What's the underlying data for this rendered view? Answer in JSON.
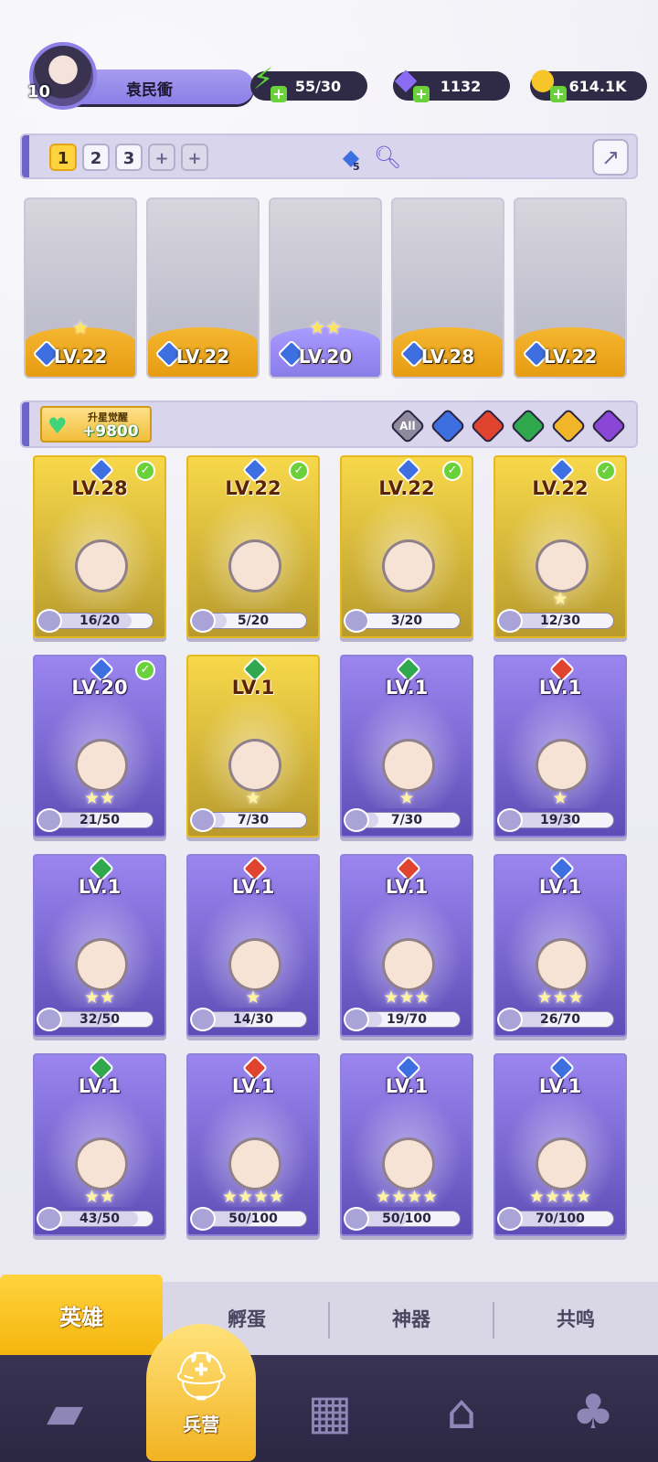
{
  "player": {
    "level": "10",
    "name": "袁民衝"
  },
  "resources": [
    {
      "icon": "energy-icon",
      "value": "55/30",
      "color": "#5fd13a"
    },
    {
      "icon": "gem-icon",
      "value": "1132",
      "color": "#8a6cf2"
    },
    {
      "icon": "coin-icon",
      "value": "614.1K",
      "color": "#f5c52a"
    }
  ],
  "team": {
    "tabs": [
      "1",
      "2",
      "3"
    ],
    "add_labels": [
      "+",
      "+"
    ],
    "active_tab": "1",
    "badge_count": "5"
  },
  "team_slots": [
    {
      "lv": "LV.22",
      "stars": "★",
      "frame": "gold"
    },
    {
      "lv": "LV.22",
      "stars": "",
      "frame": "gold"
    },
    {
      "lv": "LV.20",
      "stars": "★★",
      "frame": "purple"
    },
    {
      "lv": "LV.28",
      "stars": "",
      "frame": "gold"
    },
    {
      "lv": "LV.22",
      "stars": "",
      "frame": "gold"
    }
  ],
  "awaken": {
    "title": "升星觉醒",
    "value": "+9800"
  },
  "filters": [
    {
      "label": "All",
      "color": "#8f8a9e"
    },
    {
      "label": "",
      "color": "#3d6fe0"
    },
    {
      "label": "",
      "color": "#e0442e"
    },
    {
      "label": "",
      "color": "#2fa84e"
    },
    {
      "label": "",
      "color": "#f1b52a"
    },
    {
      "label": "",
      "color": "#8a47d6"
    }
  ],
  "heroes": [
    {
      "lv": "LV.28",
      "progress": "16/20",
      "fill": 0.8,
      "frame": "gold",
      "element": "#3d6fe0",
      "checked": true,
      "stars": ""
    },
    {
      "lv": "LV.22",
      "progress": "5/20",
      "fill": 0.25,
      "frame": "gold",
      "element": "#3d6fe0",
      "checked": true,
      "stars": ""
    },
    {
      "lv": "LV.22",
      "progress": "3/20",
      "fill": 0.15,
      "frame": "gold",
      "element": "#3d6fe0",
      "checked": true,
      "stars": ""
    },
    {
      "lv": "LV.22",
      "progress": "12/30",
      "fill": 0.4,
      "frame": "gold",
      "element": "#3d6fe0",
      "checked": true,
      "stars": "★"
    },
    {
      "lv": "LV.20",
      "progress": "21/50",
      "fill": 0.42,
      "frame": "purple",
      "element": "#3d6fe0",
      "checked": true,
      "stars": "★★"
    },
    {
      "lv": "LV.1",
      "progress": "7/30",
      "fill": 0.23,
      "frame": "gold",
      "element": "#2fa84e",
      "checked": false,
      "stars": "★"
    },
    {
      "lv": "LV.1",
      "progress": "7/30",
      "fill": 0.23,
      "frame": "purple",
      "element": "#2fa84e",
      "checked": false,
      "stars": "★"
    },
    {
      "lv": "LV.1",
      "progress": "19/30",
      "fill": 0.63,
      "frame": "purple",
      "element": "#e0442e",
      "checked": false,
      "stars": "★"
    },
    {
      "lv": "LV.1",
      "progress": "32/50",
      "fill": 0.64,
      "frame": "purple",
      "element": "#2fa84e",
      "checked": false,
      "stars": "★★"
    },
    {
      "lv": "LV.1",
      "progress": "14/30",
      "fill": 0.47,
      "frame": "purple",
      "element": "#e0442e",
      "checked": false,
      "stars": "★"
    },
    {
      "lv": "LV.1",
      "progress": "19/70",
      "fill": 0.27,
      "frame": "purple",
      "element": "#e0442e",
      "checked": false,
      "stars": "★★★"
    },
    {
      "lv": "LV.1",
      "progress": "26/70",
      "fill": 0.37,
      "frame": "purple",
      "element": "#3d6fe0",
      "checked": false,
      "stars": "★★★"
    },
    {
      "lv": "LV.1",
      "progress": "43/50",
      "fill": 0.86,
      "frame": "purple",
      "element": "#2fa84e",
      "checked": false,
      "stars": "★★"
    },
    {
      "lv": "LV.1",
      "progress": "50/100",
      "fill": 0.5,
      "frame": "purple",
      "element": "#e0442e",
      "checked": false,
      "stars": "★★★★"
    },
    {
      "lv": "LV.1",
      "progress": "50/100",
      "fill": 0.5,
      "frame": "purple",
      "element": "#3d6fe0",
      "checked": false,
      "stars": "★★★★"
    },
    {
      "lv": "LV.1",
      "progress": "70/100",
      "fill": 0.7,
      "frame": "purple",
      "element": "#3d6fe0",
      "checked": false,
      "stars": "★★★★"
    }
  ],
  "subtabs": [
    "英雄",
    "孵蛋",
    "神器",
    "共鸣"
  ],
  "nav": {
    "items": [
      {
        "icon": "cards-icon",
        "label": ""
      },
      {
        "icon": "barracks-icon",
        "label": "兵营"
      },
      {
        "icon": "map-icon",
        "label": ""
      },
      {
        "icon": "castle-icon",
        "label": ""
      },
      {
        "icon": "mushroom-icon",
        "label": ""
      }
    ]
  }
}
